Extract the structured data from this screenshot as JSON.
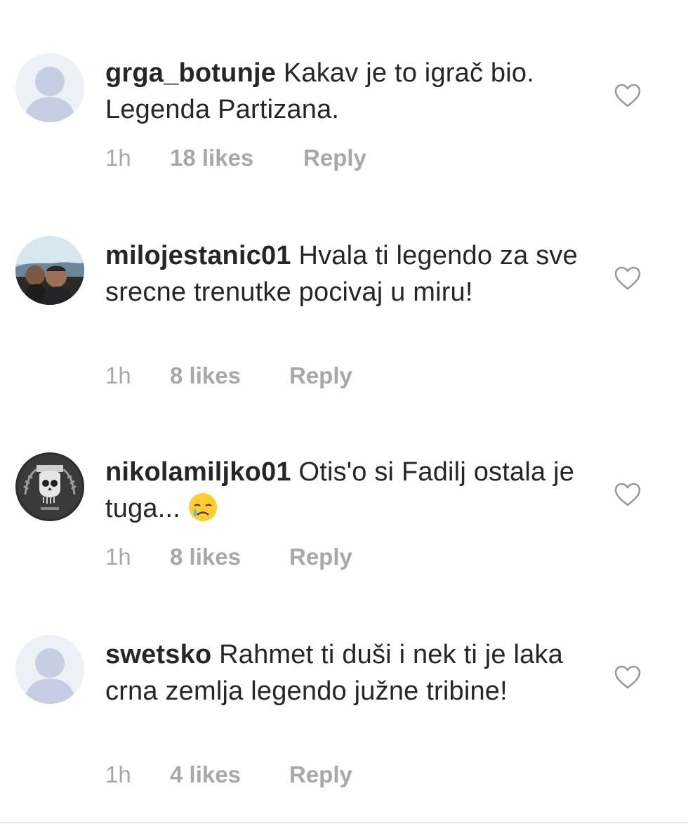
{
  "comments": [
    {
      "username": "grga_botunje",
      "text": "Kakav je to igrač bio. Legenda Partizana.",
      "time": "1h",
      "likes": "18 likes",
      "reply": "Reply",
      "avatar": "default-avatar"
    },
    {
      "username": "milojestanic01",
      "text": "Hvala ti legendo za sve srecne trenutke pocivaj u miru!",
      "time": "1h",
      "likes": "8 likes",
      "reply": "Reply",
      "avatar": "photo-avatar"
    },
    {
      "username": "nikolamiljko01",
      "text": "Otis'o si Fadilj ostala je tuga...",
      "time": "1h",
      "likes": "8 likes",
      "reply": "Reply",
      "avatar": "skull-emblem-avatar",
      "emoji": "crying-face"
    },
    {
      "username": "swetsko",
      "text": "Rahmet ti duši i nek ti je laka crna zemlja legendo južne tribine!",
      "time": "1h",
      "likes": "4 likes",
      "reply": "Reply",
      "avatar": "default-avatar"
    }
  ],
  "colors": {
    "text": "#262626",
    "meta": "#a8a8a8",
    "avatar_bg": "#eef0f7",
    "avatar_silhouette": "#c7cde3",
    "heart": "#9a9a9a"
  }
}
